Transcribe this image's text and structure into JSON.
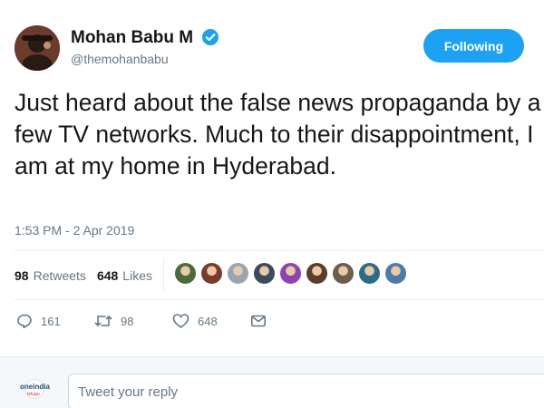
{
  "author": {
    "name": "Mohan Babu M",
    "handle": "@themohanbabu",
    "verified_icon": "verified-badge-icon",
    "avatar_icon": "avatar"
  },
  "follow_button": {
    "label": "Following"
  },
  "tweet": {
    "text": "Just heard about the false news propaganda by a few TV networks. Much to their disappointment, I am at my home in Hyderabad.",
    "timestamp": "1:53 PM - 2 Apr 2019"
  },
  "stats": {
    "retweets_count": "98",
    "retweets_label": "Retweets",
    "likes_count": "648",
    "likes_label": "Likes"
  },
  "likers": [
    "#4a6b3a",
    "#7a3b2c",
    "#9aa5b1",
    "#3d4a5c",
    "#8e44ad",
    "#5a3e2b",
    "#6d5d4b",
    "#2e6a8a",
    "#4f7aa8"
  ],
  "actions": {
    "reply_count": "161",
    "retweet_count": "98",
    "like_count": "648"
  },
  "reply": {
    "placeholder": "Tweet your reply",
    "brand_text": "oneindia",
    "brand_sub": "telugu"
  },
  "colors": {
    "accent": "#1da1f2",
    "text": "#14171a",
    "muted": "#657786"
  }
}
